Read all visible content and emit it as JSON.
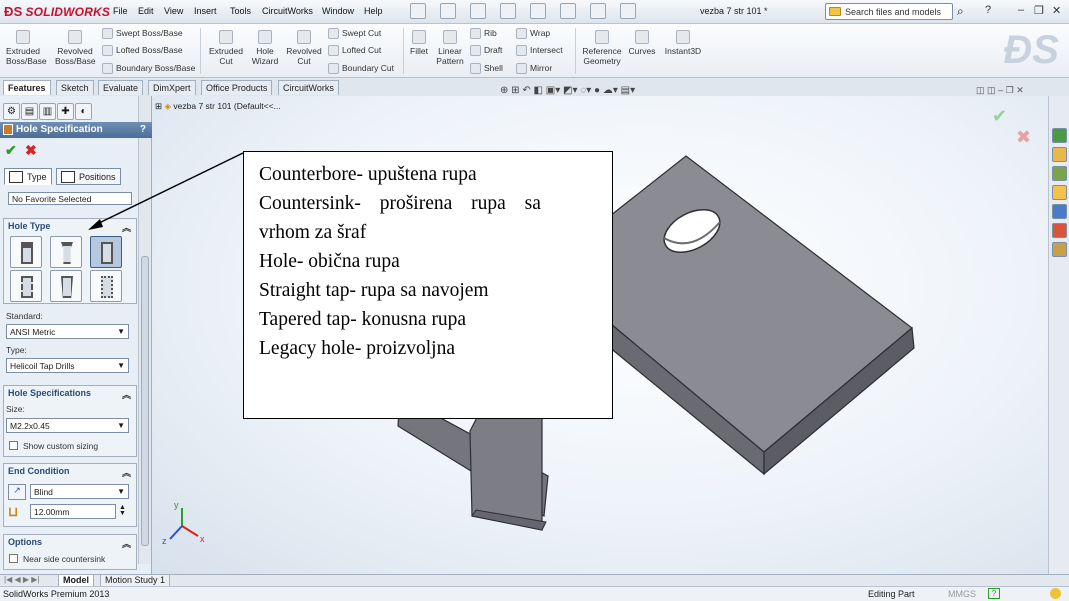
{
  "app": {
    "logo": "SOLIDWORKS",
    "document_title": "vezba 7 str 101 *",
    "menu": [
      "File",
      "Edit",
      "View",
      "Insert",
      "Tools",
      "CircuitWorks",
      "Window",
      "Help"
    ],
    "search_placeholder": "Search files and models",
    "status_product": "SolidWorks Premium 2013",
    "status_mode": "Editing Part",
    "status_units": "MMGS"
  },
  "ribbon": {
    "extruded_boss": "Extruded Boss/Base",
    "revolved_boss": "Revolved Boss/Base",
    "swept_boss": "Swept Boss/Base",
    "lofted_boss": "Lofted Boss/Base",
    "boundary_boss": "Boundary Boss/Base",
    "extruded_cut": "Extruded Cut",
    "hole_wizard": "Hole Wizard",
    "revolved_cut": "Revolved Cut",
    "swept_cut": "Swept Cut",
    "lofted_cut": "Lofted Cut",
    "boundary_cut": "Boundary Cut",
    "fillet": "Fillet",
    "linear_pattern": "Linear Pattern",
    "rib": "Rib",
    "draft": "Draft",
    "shell": "Shell",
    "wrap": "Wrap",
    "intersect": "Intersect",
    "mirror": "Mirror",
    "reference_geometry": "Reference Geometry",
    "curves": "Curves",
    "instant3d": "Instant3D"
  },
  "command_tabs": [
    "Features",
    "Sketch",
    "Evaluate",
    "DimXpert",
    "Office Products",
    "CircuitWorks"
  ],
  "property_manager": {
    "title": "Hole Specification",
    "help": "?",
    "tab_type": "Type",
    "tab_positions": "Positions",
    "favorite": "No Favorite Selected",
    "hole_type_header": "Hole Type",
    "hole_types": [
      "counterbore",
      "countersink",
      "hole",
      "straight-tap",
      "tapered-tap",
      "legacy-hole"
    ],
    "selected_hole_type": "hole",
    "standard_label": "Standard:",
    "standard_value": "ANSI Metric",
    "type_label": "Type:",
    "type_value": "Helicoil Tap Drills",
    "hole_spec_header": "Hole Specifications",
    "size_label": "Size:",
    "size_value": "M2.2x0.45",
    "custom_sizing": "Show custom sizing",
    "end_condition_header": "End Condition",
    "end_condition_value": "Blind",
    "depth_value": "12.00mm",
    "options_header": "Options",
    "near_side": "Near side countersink"
  },
  "feature_tree": {
    "root": "vezba 7 str 101  (Default<<..."
  },
  "bottom_tabs": [
    "Model",
    "Motion Study 1"
  ],
  "annotation": {
    "lines": [
      "Counterbore- upuštena rupa",
      "Countersink- proširena rupa sa",
      "vrhom za šraf",
      "Hole- obična rupa",
      "Straight tap- rupa sa navojem",
      "Tapered tap- konusna rupa",
      "Legacy hole- proizvoljna"
    ]
  },
  "colors": {
    "accent": "#4b6d96",
    "part_top": "#8a8a92",
    "part_side": "#6a6a72",
    "ok": "#2a9d2a",
    "cancel": "#dd2222"
  },
  "triad": {
    "x": "x",
    "y": "y",
    "z": "z"
  }
}
